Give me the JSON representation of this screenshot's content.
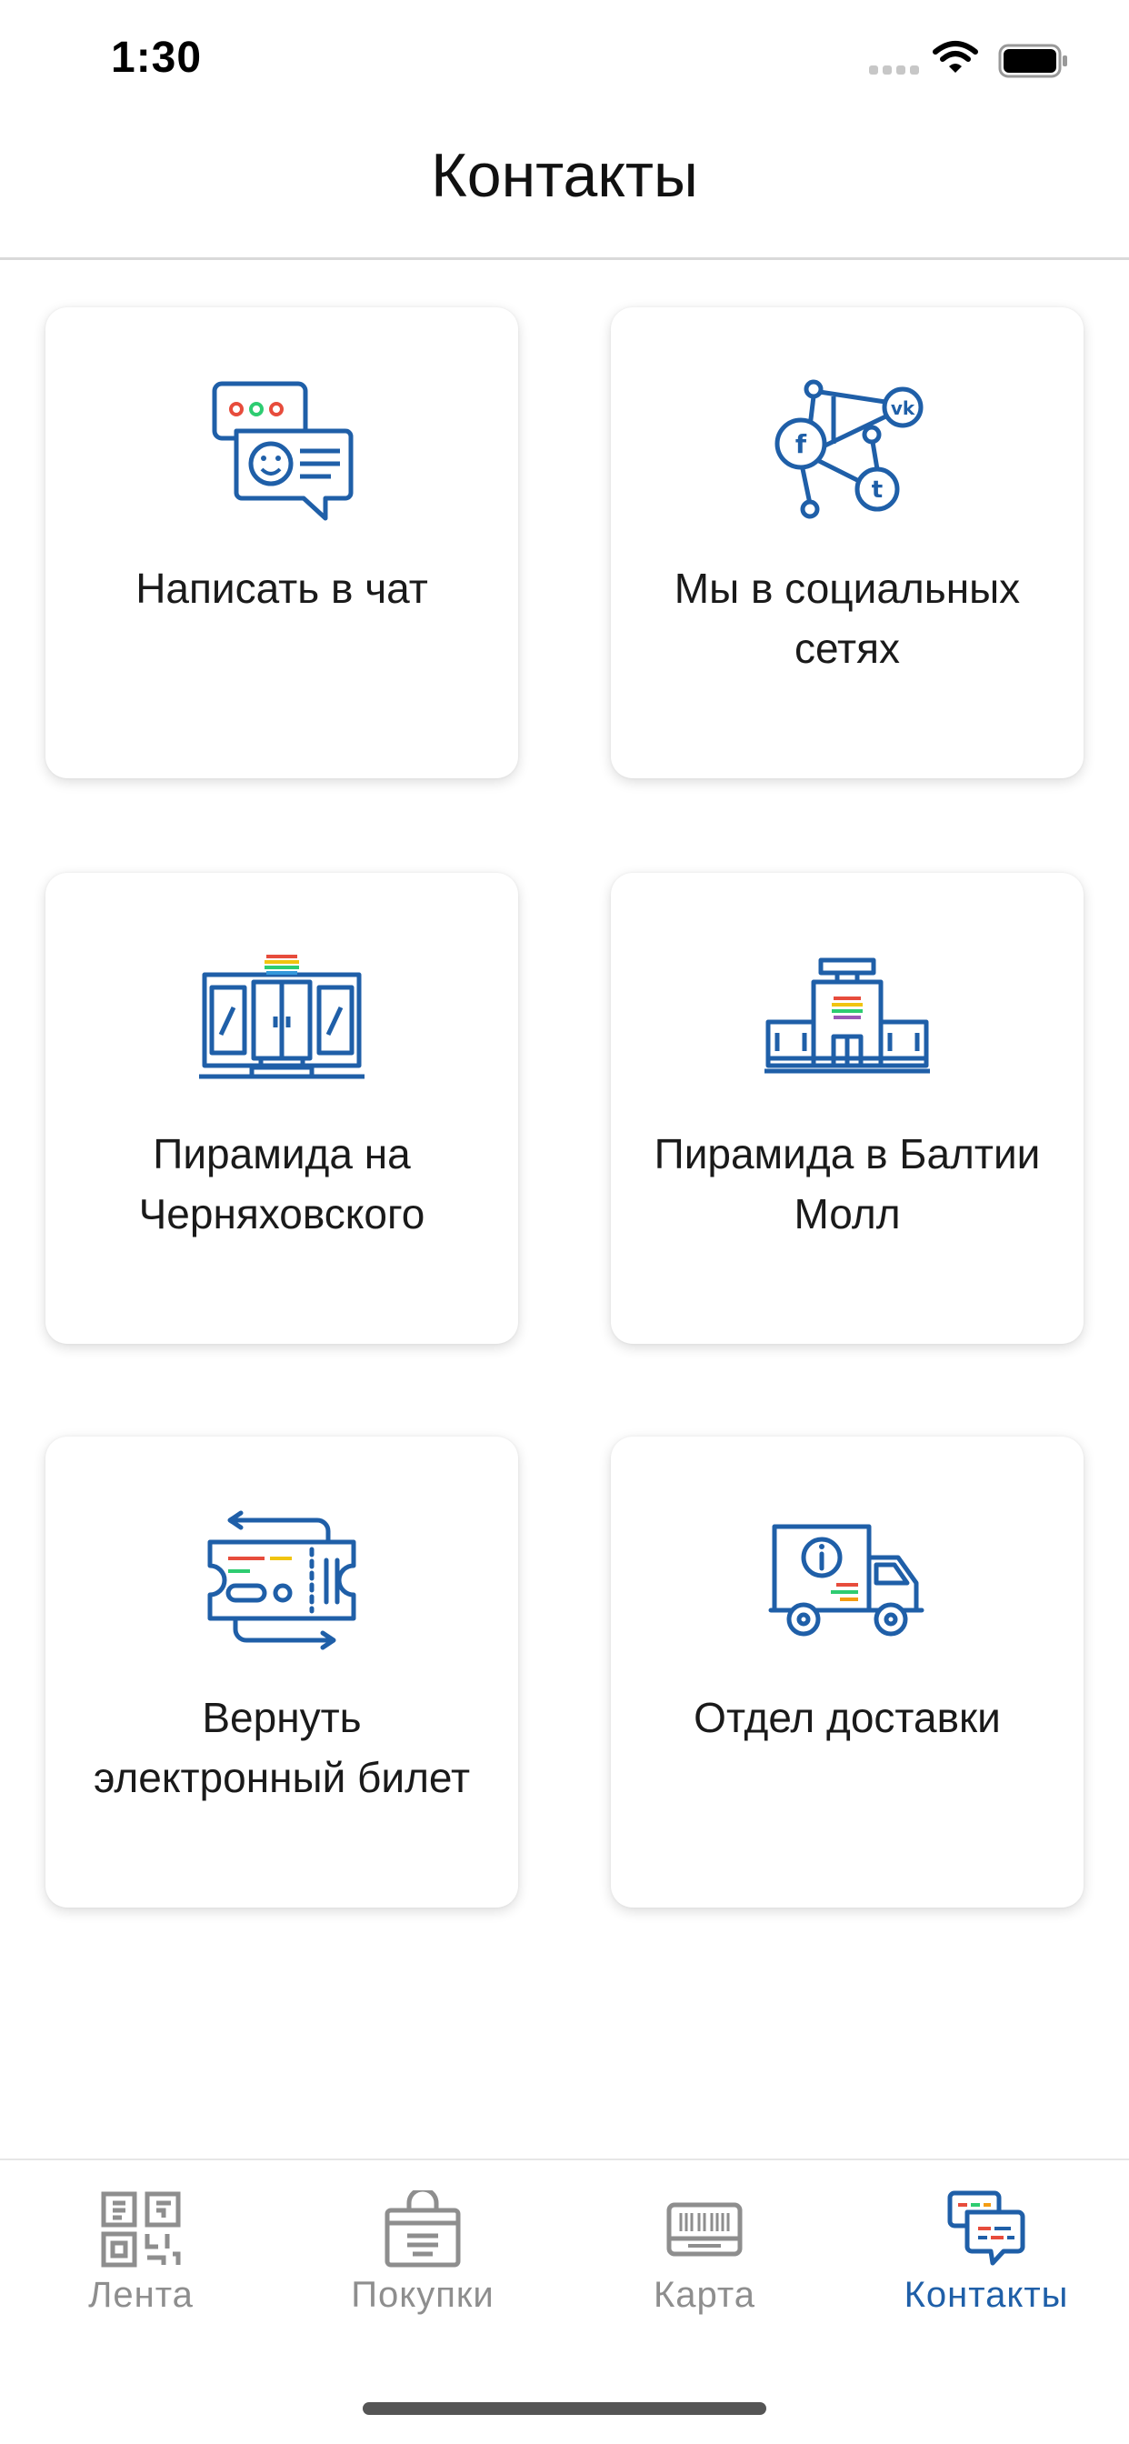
{
  "status_bar": {
    "time": "1:30",
    "icons": [
      "cellular-signal-icon",
      "wifi-icon",
      "battery-icon"
    ]
  },
  "header": {
    "title": "Контакты"
  },
  "cards": [
    {
      "label": "Написать в чат",
      "icon": "chat-bubbles-icon"
    },
    {
      "label": "Мы в социальных сетях",
      "icon": "social-network-icon"
    },
    {
      "label": "Пирамида на Черняховского",
      "icon": "store-front-icon"
    },
    {
      "label": "Пирамида в Балтии Молл",
      "icon": "mall-building-icon"
    },
    {
      "label": "Вернуть электронный билет",
      "icon": "ticket-return-icon"
    },
    {
      "label": "Отдел доставки",
      "icon": "delivery-truck-icon"
    }
  ],
  "tab_bar": {
    "tabs": [
      {
        "label": "Лента",
        "icon": "feed-qr-icon",
        "active": false
      },
      {
        "label": "Покупки",
        "icon": "shopping-bag-icon",
        "active": false
      },
      {
        "label": "Карта",
        "icon": "barcode-card-icon",
        "active": false
      },
      {
        "label": "Контакты",
        "icon": "contacts-chat-icon",
        "active": true
      }
    ]
  },
  "colors": {
    "accent": "#1f5fa8",
    "icon_blue": "#1f5fa8",
    "tab_inactive": "#8e8e8e",
    "rainbow": [
      "#e74c3c",
      "#f39c12",
      "#f1c40f",
      "#2ecc71",
      "#3498db",
      "#9b59b6"
    ]
  }
}
